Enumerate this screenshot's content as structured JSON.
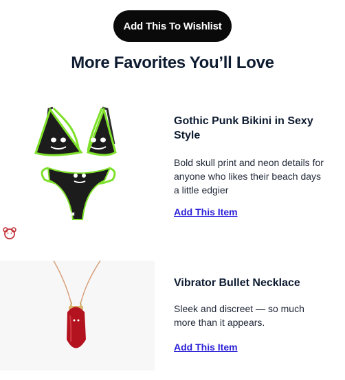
{
  "wishlist_button": "Add This To Wishlist",
  "section_title": "More Favorites You’ll Love",
  "products": [
    {
      "name": "Gothic Punk Bikini in Sexy Style",
      "description": "Bold skull print and neon details for anyone who likes their beach days a little edgier",
      "link": "Add This Item",
      "image_icon": "skull-bikini-image"
    },
    {
      "name": "Vibrator Bullet Necklace",
      "description": "Sleek and discreet — so much more than it appears.",
      "link": "Add This Item",
      "image_icon": "bullet-necklace-image"
    }
  ],
  "colors": {
    "button_bg": "#0a0a0a",
    "title_text": "#0d1b30",
    "link": "#2a1fd6",
    "neon_green": "#7ee02a",
    "necklace_red": "#b3121f",
    "bear_icon": "#c2363c"
  }
}
